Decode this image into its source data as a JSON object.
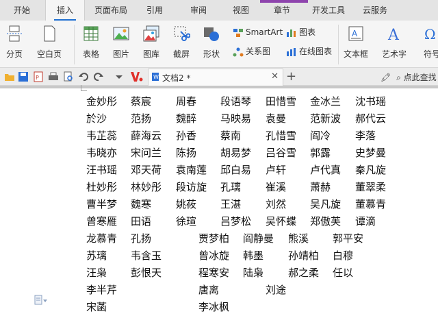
{
  "menu": {
    "tabs": [
      "开始",
      "插入",
      "页面布局",
      "引用",
      "审阅",
      "视图",
      "章节",
      "开发工具",
      "云服务"
    ],
    "active": "插入"
  },
  "ribbon": {
    "page_break": "分页",
    "blank_page": "空白页",
    "table": "表格",
    "picture": "图片",
    "gallery": "图库",
    "screenshot": "截屏",
    "shape": "形状",
    "smartart": "SmartArt",
    "chart": "图表",
    "relation": "关系图",
    "online_chart": "在线图表",
    "textbox": "文本框",
    "art_text": "艺术字",
    "symbol": "符号"
  },
  "quickbar": {
    "doc_tab": "文档2 *",
    "search_hint": "点此查找"
  },
  "names": {
    "rows": [
      [
        "金妙彤",
        "蔡宸",
        "周春",
        "段语琴",
        "田惜雪",
        "金冰兰",
        "沈书瑶"
      ],
      [
        "於沙",
        "范扬",
        "魏醉",
        "马映易",
        "袁曼",
        "范新波",
        "郝代云"
      ],
      [
        "韦芷蕊",
        "薛海云",
        "孙香",
        "蔡南",
        "孔惜雪",
        "阎冷",
        "李落"
      ],
      [
        "韦晓亦",
        "宋问兰",
        "陈扬",
        "胡易梦",
        "吕谷雪",
        "郭露",
        "史梦曼"
      ],
      [
        "汪书瑶",
        "邓天荷",
        "袁南莲",
        "邱白易",
        "卢轩",
        "卢代真",
        "秦凡旋"
      ],
      [
        "杜妙彤",
        "林妙彤",
        "段访旋",
        "孔璃",
        "崔溪",
        "萧赫",
        "董翠柔"
      ],
      [
        "曹半梦",
        "魏寒",
        "姚莜",
        "王湛",
        "刘然",
        "吴凡旋",
        "董慕青"
      ],
      [
        "曾寒雁",
        "田语",
        "徐瑄",
        "吕梦松",
        "吴怀蝶",
        "郑傲芙",
        "谭滴"
      ]
    ],
    "lower": [
      [
        "龙慕青",
        "孔扬",
        "贾梦柏",
        "阎静曼",
        "熊溪",
        "郭平安"
      ],
      [
        "苏璃",
        "韦含玉",
        "曾冰旋",
        "韩墨",
        "孙靖柏",
        "白穆"
      ],
      [
        "汪枭",
        "彭恨天",
        "程寒安",
        "陆枭",
        "郝之柔",
        "任以"
      ],
      [
        "李半芹",
        "唐离",
        "刘途"
      ],
      [
        "宋菡",
        "李冰枫"
      ]
    ]
  }
}
